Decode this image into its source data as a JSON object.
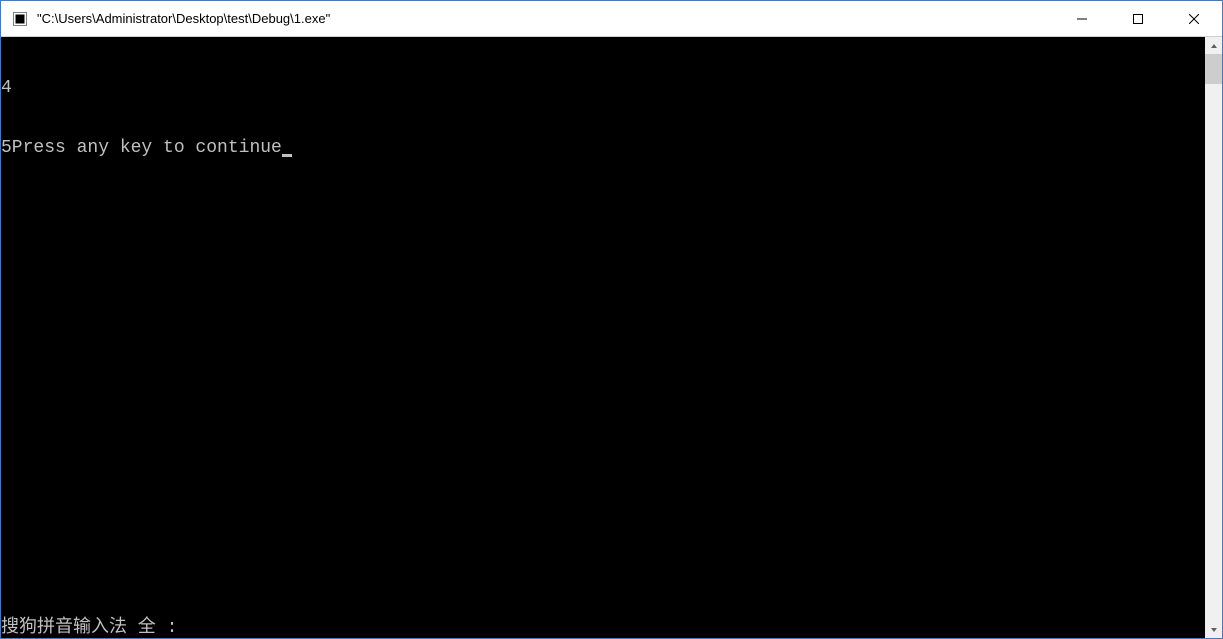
{
  "window": {
    "title": "\"C:\\Users\\Administrator\\Desktop\\test\\Debug\\1.exe\""
  },
  "console": {
    "line1": "4",
    "line2": "5Press any key to continue",
    "ime_status": "搜狗拼音输入法 全 :"
  }
}
